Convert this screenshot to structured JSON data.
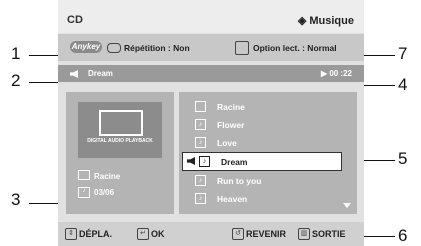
{
  "callouts": [
    "1",
    "2",
    "3",
    "4",
    "5",
    "6",
    "7"
  ],
  "header": {
    "left": "CD",
    "right": "◈ Musique"
  },
  "options": {
    "anykey": "Anykey",
    "repeat": "Répétition : Non",
    "option": "Option lect. : Normal"
  },
  "playing": {
    "track": "Dream",
    "time": "▶ 00 :22"
  },
  "left_info": {
    "folder": "Racine",
    "count": "03/06",
    "logo_text": "DIGITAL AUDIO PLAYBACK"
  },
  "list": {
    "items": [
      {
        "label": "Racine",
        "icon": "folder-icon"
      },
      {
        "label": "Flower",
        "icon": "music-file-icon"
      },
      {
        "label": "Love",
        "icon": "music-file-icon"
      },
      {
        "label": "Dream",
        "icon": "music-file-icon"
      },
      {
        "label": "Run to you",
        "icon": "music-file-icon"
      },
      {
        "label": "Heaven",
        "icon": "music-file-icon"
      }
    ]
  },
  "footer": {
    "move": "DÉPLA.",
    "ok": "OK",
    "back": "REVENIR",
    "exit": "SORTIE"
  }
}
